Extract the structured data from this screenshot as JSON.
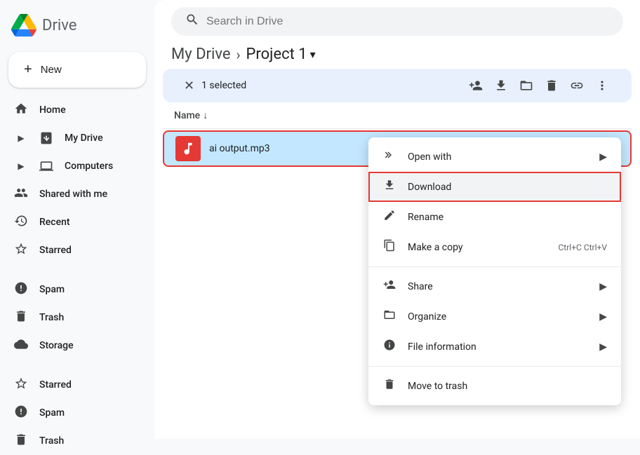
{
  "app": {
    "title": "Drive",
    "logo_alt": "Google Drive Logo"
  },
  "search": {
    "placeholder": "Search in Drive"
  },
  "new_button": {
    "label": "New"
  },
  "sidebar": {
    "items": [
      {
        "id": "home",
        "label": "Home",
        "icon": "🏠"
      },
      {
        "id": "my-drive",
        "label": "My Drive",
        "icon": "▶"
      },
      {
        "id": "computers",
        "label": "Computers",
        "icon": "▶"
      },
      {
        "id": "shared-with-me",
        "label": "Shared with me",
        "icon": "👤"
      },
      {
        "id": "recent",
        "label": "Recent",
        "icon": "🕐"
      },
      {
        "id": "starred",
        "label": "Starred",
        "icon": "☆"
      },
      {
        "id": "spam",
        "label": "Spam",
        "icon": "🚫"
      },
      {
        "id": "trash",
        "label": "Trash",
        "icon": "🗑"
      },
      {
        "id": "storage",
        "label": "Storage",
        "icon": "☁"
      },
      {
        "id": "starred2",
        "label": "Starred",
        "icon": "☆"
      },
      {
        "id": "spam2",
        "label": "Spam",
        "icon": "🚫"
      },
      {
        "id": "trash2",
        "label": "Trash",
        "icon": "🗑"
      }
    ]
  },
  "breadcrumb": {
    "parent": "My Drive",
    "separator": "›",
    "current": "Project 1",
    "dropdown_arrow": "▾"
  },
  "toolbar": {
    "close_icon": "✕",
    "selected_text": "1 selected",
    "actions": [
      {
        "id": "add-person",
        "icon": "person_add",
        "label": "Share"
      },
      {
        "id": "download",
        "icon": "download",
        "label": "Download"
      },
      {
        "id": "move",
        "icon": "drive_move",
        "label": "Move to folder"
      },
      {
        "id": "delete",
        "icon": "delete",
        "label": "Remove"
      },
      {
        "id": "link",
        "icon": "link",
        "label": "Get link"
      },
      {
        "id": "more",
        "icon": "more_vert",
        "label": "More actions"
      }
    ]
  },
  "file_list": {
    "column_header": "Name",
    "sort_icon": "↓",
    "files": [
      {
        "id": "ai-output",
        "name": "ai output.mp3",
        "type": "mp3",
        "selected": true
      }
    ]
  },
  "context_menu": {
    "items": [
      {
        "id": "open-with",
        "label": "Open with",
        "has_arrow": true
      },
      {
        "id": "download",
        "label": "Download",
        "highlighted": true
      },
      {
        "id": "rename",
        "label": "Rename"
      },
      {
        "id": "make-copy",
        "label": "Make a copy",
        "shortcut": "Ctrl+C Ctrl+V"
      },
      {
        "id": "share",
        "label": "Share",
        "has_arrow": true
      },
      {
        "id": "organize",
        "label": "Organize",
        "has_arrow": true
      },
      {
        "id": "file-information",
        "label": "File information",
        "has_arrow": true
      },
      {
        "id": "move-to-trash",
        "label": "Move to trash"
      }
    ]
  }
}
